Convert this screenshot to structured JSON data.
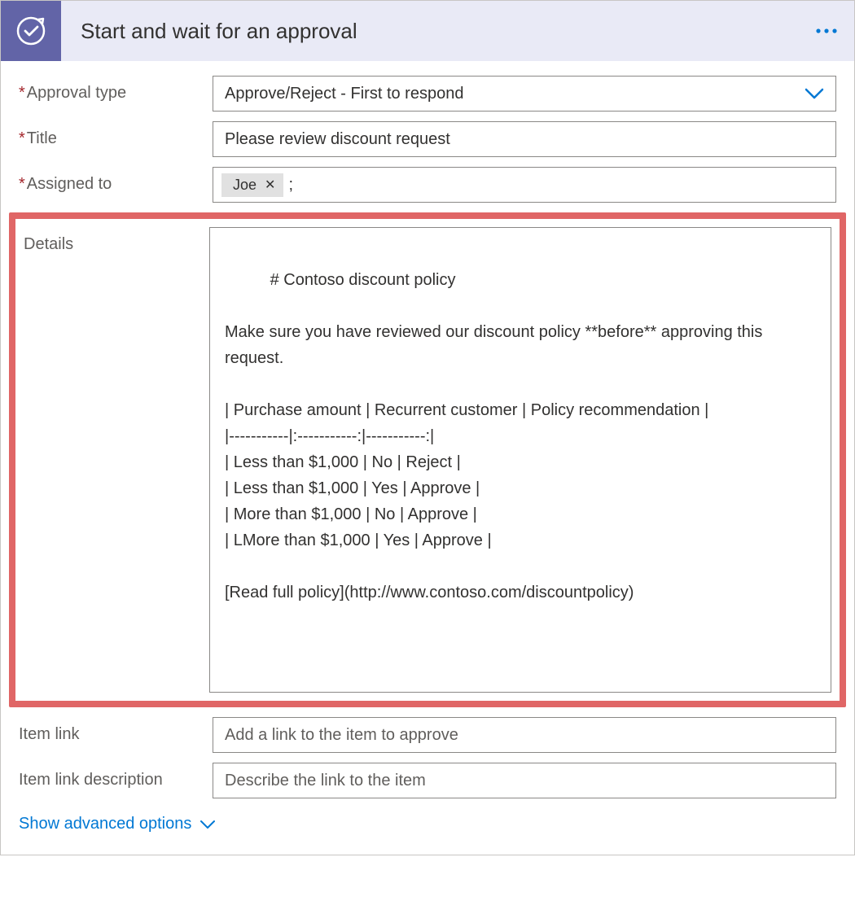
{
  "header": {
    "title": "Start and wait for an approval"
  },
  "labels": {
    "approval_type": "Approval type",
    "title": "Title",
    "assigned_to": "Assigned to",
    "details": "Details",
    "item_link": "Item link",
    "item_link_description": "Item link description"
  },
  "values": {
    "approval_type": "Approve/Reject - First to respond",
    "title": "Please review discount request",
    "assigned_to_pill": "Joe",
    "assigned_to_trailing": ";",
    "details": "# Contoso discount policy\n\nMake sure you have reviewed our discount policy **before** approving this request.\n\n| Purchase amount | Recurrent customer | Policy recommendation |\n|-----------|:-----------:|-----------:|\n| Less than $1,000 | No | Reject |\n| Less than $1,000 | Yes | Approve |\n| More than $1,000 | No | Approve |\n| LMore than $1,000 | Yes | Approve |\n\n[Read full policy](http://www.contoso.com/discountpolicy)"
  },
  "placeholders": {
    "item_link": "Add a link to the item to approve",
    "item_link_description": "Describe the link to the item"
  },
  "footer": {
    "advanced": "Show advanced options"
  }
}
